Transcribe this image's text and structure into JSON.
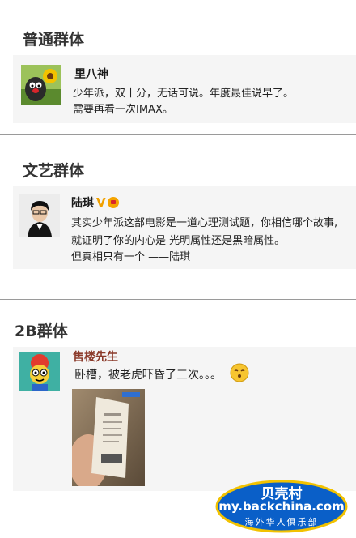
{
  "sections": [
    {
      "title": "普通群体",
      "post": {
        "author": "里八神",
        "lines": [
          "少年派，双十分，无话可说。年度最佳说早了。",
          "需要再看一次IMAX。"
        ]
      }
    },
    {
      "title": "文艺群体",
      "post": {
        "author": "陆琪",
        "badge_v": "V",
        "lines": [
          "其实少年派这部电影是一道心理测试题，你相信哪个故事,",
          "就证明了你的内心是  光明属性还是黑暗属性。",
          "但真相只有一个 ——陆琪"
        ]
      }
    },
    {
      "title": "2B群体",
      "post": {
        "author": "售楼先生",
        "lines": [
          "卧槽，被老虎吓昏了三次。。。"
        ],
        "emoji": "shy-face"
      }
    }
  ],
  "watermark": {
    "title": "贝壳村",
    "url": "my.backchina.com",
    "subtitle": "海外华人俱乐部"
  },
  "colors": {
    "card_bg": "#f5f5f5",
    "name_blue": "#1a1a1a",
    "name_brown": "#8b3a2a",
    "watermark_blue": "#0a5fc8"
  }
}
